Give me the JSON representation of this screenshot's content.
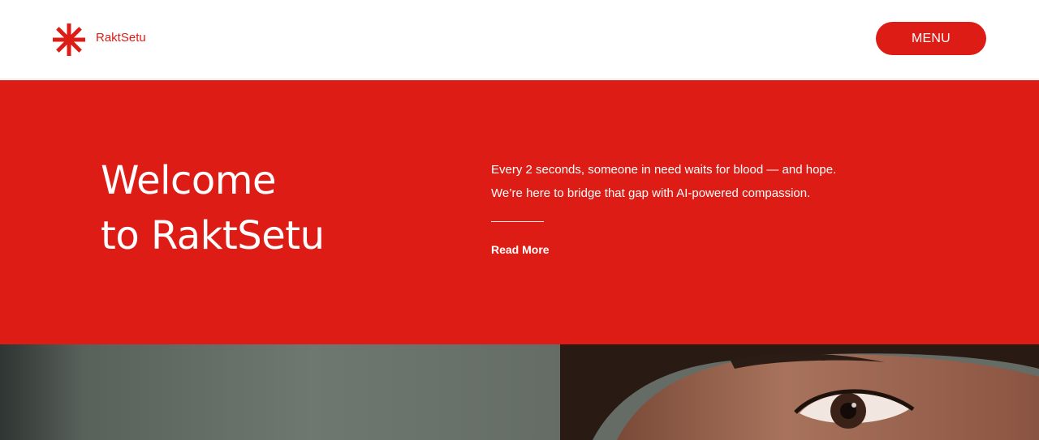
{
  "header": {
    "brand_name": "RaktSetu",
    "logo_icon": "asterisk-icon",
    "menu_label": "MENU"
  },
  "hero": {
    "title_line1": "Welcome",
    "title_line2": "to RaktSetu",
    "desc_line1": "Every 2 seconds, someone in need waits for blood — and hope.",
    "desc_line2": "We’re here to bridge that gap with AI-powered compassion.",
    "read_more_label": "Read More"
  },
  "colors": {
    "brand_red": "#dd1c16",
    "white": "#ffffff"
  }
}
